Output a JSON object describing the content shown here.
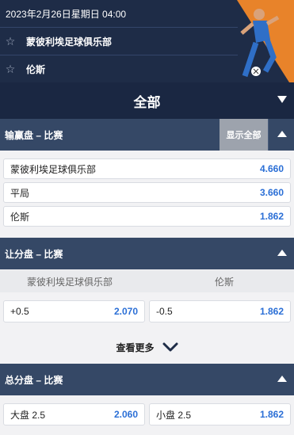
{
  "header": {
    "datetime": "2023年2月26日星期日 04:00",
    "home_team": "蒙彼利埃足球俱乐部",
    "away_team": "伦斯",
    "star_icon": "star-outline-icon"
  },
  "filter": {
    "label": "全部"
  },
  "moneyline": {
    "title": "输赢盘 – 比赛",
    "show_all": "显示全部",
    "rows": [
      {
        "label": "蒙彼利埃足球俱乐部",
        "odds": "4.660"
      },
      {
        "label": "平局",
        "odds": "3.660"
      },
      {
        "label": "伦斯",
        "odds": "1.862"
      }
    ]
  },
  "handicap": {
    "title": "让分盘 – 比赛",
    "col_home": "蒙彼利埃足球俱乐部",
    "col_away": "伦斯",
    "home": {
      "line": "+0.5",
      "odds": "2.070"
    },
    "away": {
      "line": "-0.5",
      "odds": "1.862"
    },
    "see_more": "查看更多"
  },
  "totals": {
    "title": "总分盘 – 比赛",
    "over": {
      "line": "大盘 2.5",
      "odds": "2.060"
    },
    "under": {
      "line": "小盘 2.5",
      "odds": "1.862"
    }
  },
  "colors": {
    "navy": "#1e2c47",
    "section": "#354866",
    "odds_blue": "#2b6fd6",
    "accent_orange": "#e8832a"
  }
}
